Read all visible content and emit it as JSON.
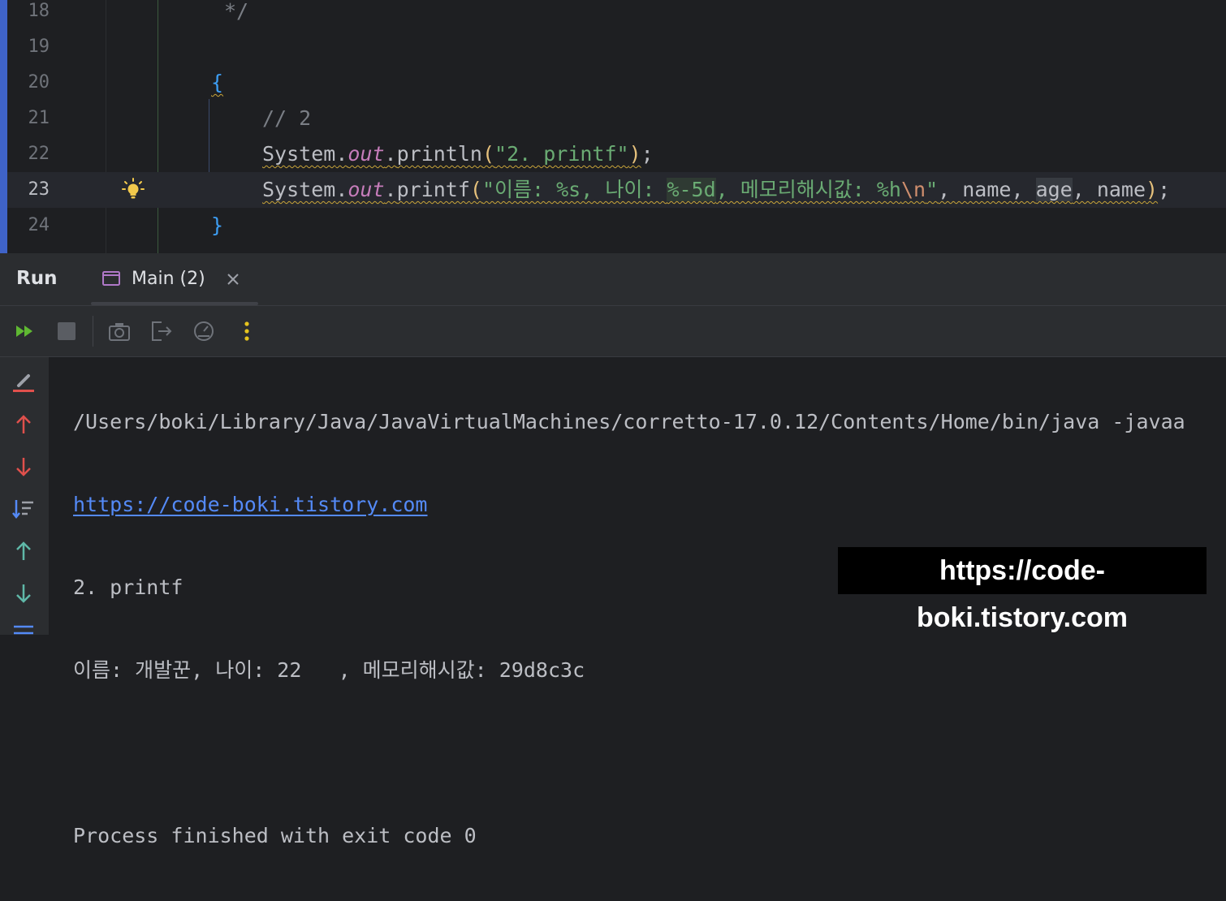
{
  "editor": {
    "lines": [
      {
        "number": "18",
        "code": "*/"
      },
      {
        "number": "19",
        "code": ""
      },
      {
        "number": "20",
        "code": "{"
      },
      {
        "number": "21",
        "code": "// 2"
      },
      {
        "number": "22",
        "code": "System.out.println(\"2. printf\");"
      },
      {
        "number": "23",
        "code": "System.out.printf(\"이름: %s, 나이: %-5d, 메모리해시값: %h\\n\", name, age, name);"
      },
      {
        "number": "24",
        "code": "}"
      }
    ],
    "tokens": {
      "comment_end": "*/",
      "brace_open": "{",
      "brace_close": "}",
      "comment": "// 2",
      "system": "System",
      "dot": ".",
      "out": "out",
      "println": "println",
      "printf": "printf",
      "paren_open": "(",
      "paren_close": ")",
      "semicolon": ";",
      "str_printf": "\"2. printf\"",
      "fmt_a": "\"이름: %s, 나이: ",
      "fmt_b": "%-5d",
      "fmt_c": ", 메모리해시값: %h",
      "fmt_esc": "\\n",
      "fmt_quote": "\"",
      "args_a": ", name, ",
      "args_b": "age",
      "args_c": ", name"
    },
    "current_line": "23",
    "colors": {
      "accent_bar": "#3f63c8",
      "string": "#6aab73",
      "field": "#c77dbb",
      "paren": "#e5c07b",
      "brace": "#3d9df2"
    }
  },
  "run_panel": {
    "title": "Run",
    "tab": {
      "label": "Main (2)"
    },
    "toolbar": {
      "rerun": "rerun-icon",
      "stop": "stop-icon",
      "screenshot": "camera-icon",
      "exit": "exit-icon",
      "profile": "gauge-icon",
      "more": "more-icon"
    },
    "sidebar": [
      "wrap-icon",
      "up-red-icon",
      "down-red-icon",
      "sort-icon",
      "up-icon",
      "down-icon",
      "menu-icon"
    ],
    "console": {
      "command": "/Users/boki/Library/Java/JavaVirtualMachines/corretto-17.0.12/Contents/Home/bin/java -javaa",
      "link": "https://code-boki.tistory.com",
      "out1": "2. printf",
      "out2": "이름: 개발꾼, 나이: 22   , 메모리해시값: 29d8c3c",
      "blank": "",
      "exit": "Process finished with exit code 0"
    }
  },
  "watermark": "https://code-boki.tistory.com"
}
